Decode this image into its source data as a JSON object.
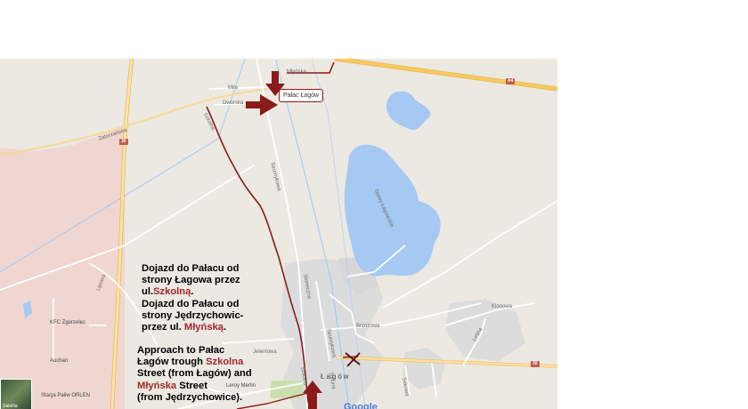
{
  "map": {
    "streets": {
      "mlynska": "Młyńska",
      "mila": "Miła",
      "dworska": "Dworska",
      "szkolna": "Szkolna",
      "zatorzanska": "Zatorzańska",
      "strumykowa": "Strumykowa",
      "stawy": "Stawy Łagowskie",
      "sloneczna": "Słoneczna",
      "brzozowa": "Brzozowa",
      "jelenia": "Jeleniowa",
      "klonowa": "Klonowa",
      "lesna": "Leśna",
      "sekowa": "Sekowa",
      "trzciny": "Trzcina",
      "szkolna_low": "Szkolna",
      "lipowa": "Lipowa",
      "strumykowa2": "Strumykowa"
    },
    "places": {
      "lagow": "Łagów",
      "kfc": "KFC Zgorzelec",
      "auchan": "Auchan",
      "orlen": "Stacja Paliw ORLEN",
      "leroy": "Leroy Merlin"
    },
    "road_shields": {
      "a4": "A4",
      "r30a": "30",
      "r30b": "30",
      "r30c": "30",
      "r30d": "30"
    },
    "palace_label": "Pałac Łagów",
    "google": "Google",
    "satellite": "Satelita",
    "colors": {
      "route": "#8b1a1a",
      "arrow": "#8b1a1a",
      "water": "#a6c9f3",
      "highway": "#f6c960",
      "built": "#dcdcdc",
      "land": "#ece9e2",
      "commercial": "#efd6d0",
      "highlight_text": "#a3262b"
    }
  },
  "text_pl": {
    "line1": "Dojazd do Pałacu od",
    "line2": "strony Łagowa przez",
    "line3_prefix": "ul.",
    "line3_hl": "Szkolną",
    "line3_suffix": ".",
    "line4": "Dojazd do Pałacu od",
    "line5": "strony Jędrzychowic-",
    "line6_prefix": "przez ul. ",
    "line6_hl": "Młyńską",
    "line6_suffix": "."
  },
  "text_en": {
    "line1": "Approach to Pałac",
    "line2_prefix": "Łagów trough ",
    "line2_hl": "Szkolna",
    "line3": "Street (from Łagów) and",
    "line4_hl": "Młyńska",
    "line4_suffix": " Street",
    "line5": "(from Jędrzychowice)."
  }
}
